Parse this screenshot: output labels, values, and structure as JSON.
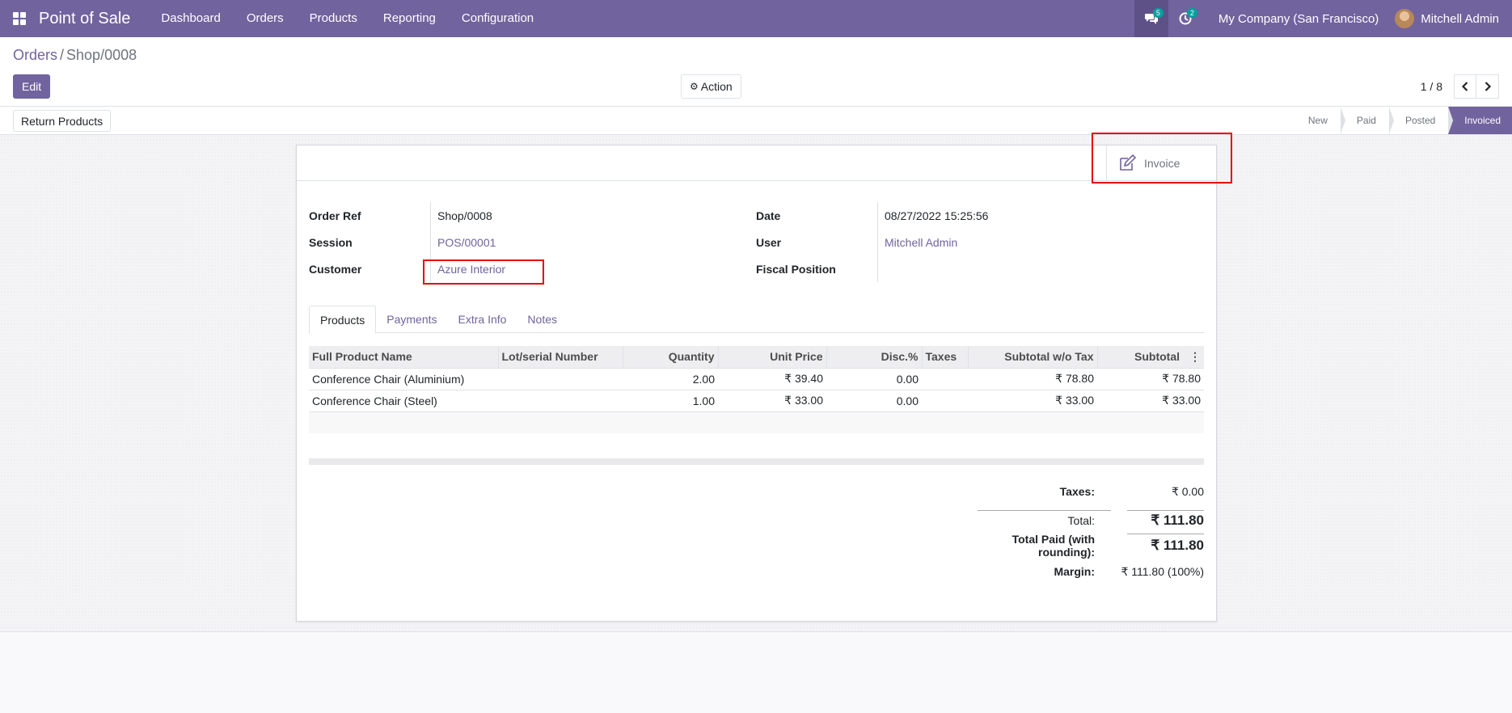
{
  "navbar": {
    "app_title": "Point of Sale",
    "menu": [
      "Dashboard",
      "Orders",
      "Products",
      "Reporting",
      "Configuration"
    ],
    "messages_badge": "5",
    "activity_badge": "2",
    "company": "My Company (San Francisco)",
    "user": "Mitchell Admin"
  },
  "breadcrumb": {
    "parent": "Orders",
    "separator": "/",
    "current": "Shop/0008"
  },
  "toolbar": {
    "edit_label": "Edit",
    "action_label": "Action"
  },
  "pager": {
    "value": "1 / 8"
  },
  "statusbar": {
    "return_label": "Return Products",
    "stages": [
      "New",
      "Paid",
      "Posted",
      "Invoiced"
    ],
    "active_stage": "Invoiced"
  },
  "smart_button": {
    "invoice_label": "Invoice"
  },
  "form": {
    "order_ref_label": "Order Ref",
    "order_ref": "Shop/0008",
    "session_label": "Session",
    "session": "POS/00001",
    "customer_label": "Customer",
    "customer": "Azure Interior",
    "date_label": "Date",
    "date": "08/27/2022 15:25:56",
    "user_label": "User",
    "user": "Mitchell Admin",
    "fiscal_label": "Fiscal Position",
    "fiscal": ""
  },
  "tabs": [
    "Products",
    "Payments",
    "Extra Info",
    "Notes"
  ],
  "table": {
    "headers": [
      "Full Product Name",
      "Lot/serial Number",
      "Quantity",
      "Unit Price",
      "Disc.%",
      "Taxes",
      "Subtotal w/o Tax",
      "Subtotal"
    ],
    "rows": [
      [
        "Conference Chair (Aluminium)",
        "",
        "2.00",
        "₹ 39.40",
        "0.00",
        "",
        "₹ 78.80",
        "₹ 78.80"
      ],
      [
        "Conference Chair (Steel)",
        "",
        "1.00",
        "₹ 33.00",
        "0.00",
        "",
        "₹ 33.00",
        "₹ 33.00"
      ]
    ]
  },
  "totals": {
    "taxes_label": "Taxes:",
    "taxes": "₹ 0.00",
    "total_label": "Total:",
    "total": "₹ 111.80",
    "paid_label": "Total Paid (with rounding):",
    "paid": "₹ 111.80",
    "margin_label": "Margin:",
    "margin": "₹ 111.80 (100%)"
  }
}
